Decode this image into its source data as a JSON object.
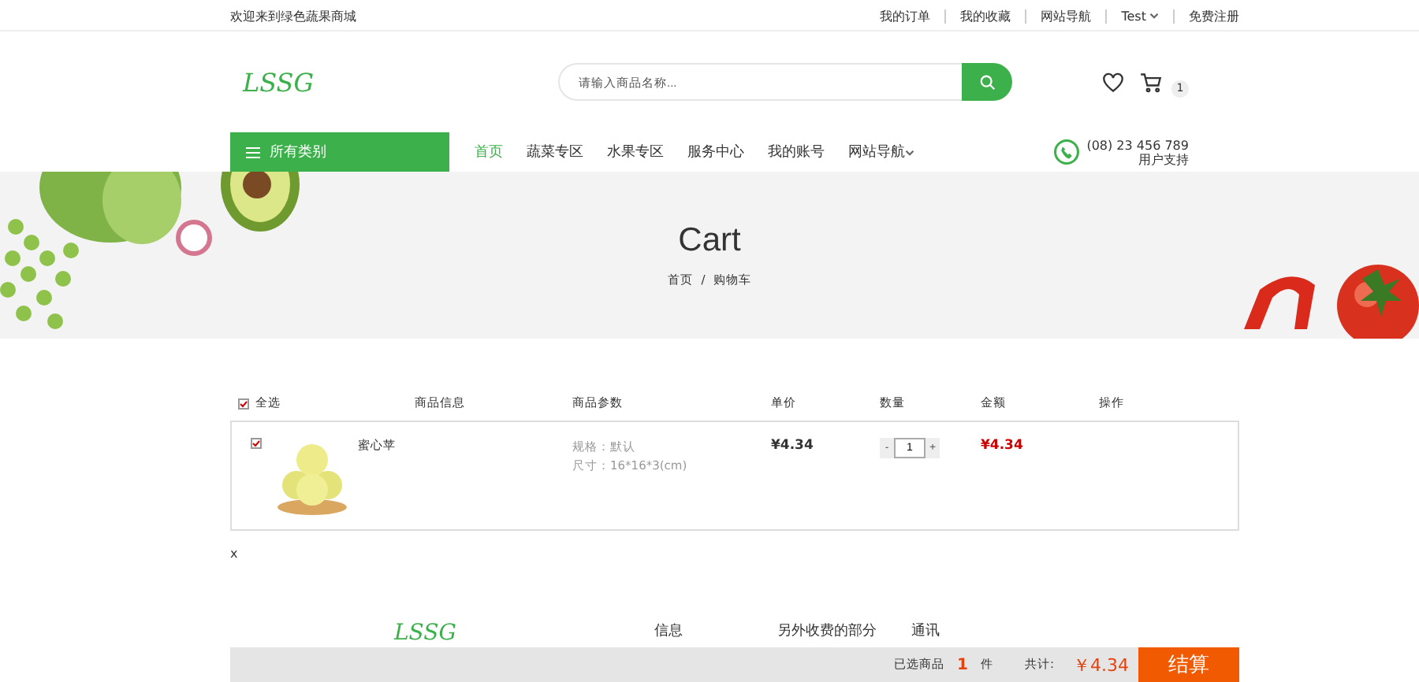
{
  "top_bar": {
    "welcome": "欢迎来到绿色蔬果商城",
    "links": [
      {
        "label": "我的订单",
        "dropdown": false
      },
      {
        "label": "我的收藏",
        "dropdown": false
      },
      {
        "label": "网站导航",
        "dropdown": false
      },
      {
        "label": "Test",
        "dropdown": true
      },
      {
        "label": "免费注册",
        "dropdown": false
      }
    ]
  },
  "header": {
    "logo": "LSSG",
    "search": {
      "placeholder": "请输入商品名称..."
    },
    "cart_count": "1"
  },
  "nav": {
    "category_button": "所有类别",
    "items": [
      {
        "label": "首页",
        "selected": true,
        "dropdown": false
      },
      {
        "label": "蔬菜专区",
        "selected": false,
        "dropdown": false
      },
      {
        "label": "水果专区",
        "selected": false,
        "dropdown": false
      },
      {
        "label": "服务中心",
        "selected": false,
        "dropdown": false
      },
      {
        "label": "我的账号",
        "selected": false,
        "dropdown": false
      },
      {
        "label": "网站导航",
        "selected": false,
        "dropdown": true
      }
    ],
    "phone": "(08) 23 456 789",
    "support": "用户支持"
  },
  "banner": {
    "title": "Cart",
    "breadcrumb": [
      "首页",
      "购物车"
    ],
    "separator": "/"
  },
  "cart": {
    "select_all": {
      "label": "全选",
      "checked": true
    },
    "columns": [
      "商品信息",
      "商品参数",
      "单价",
      "数量",
      "金额",
      "操作"
    ],
    "items": [
      {
        "checked": true,
        "name": "蜜心苹",
        "specs": [
          "规格：默认",
          "尺寸：16*16*3(cm)"
        ],
        "price": "¥4.34",
        "decrease": "-",
        "quantity": "1",
        "increase": "+",
        "total": "¥4.34"
      }
    ]
  },
  "stray_text": "x",
  "footer": {
    "logo": "LSSG",
    "columns": [
      "信息",
      "另外收费的部分",
      "通讯"
    ]
  },
  "checkout_bar": {
    "selected_label": "已选商品",
    "count": "1",
    "unit": "件",
    "total_label": "共计:",
    "total": "￥4.34",
    "button": "结算"
  }
}
